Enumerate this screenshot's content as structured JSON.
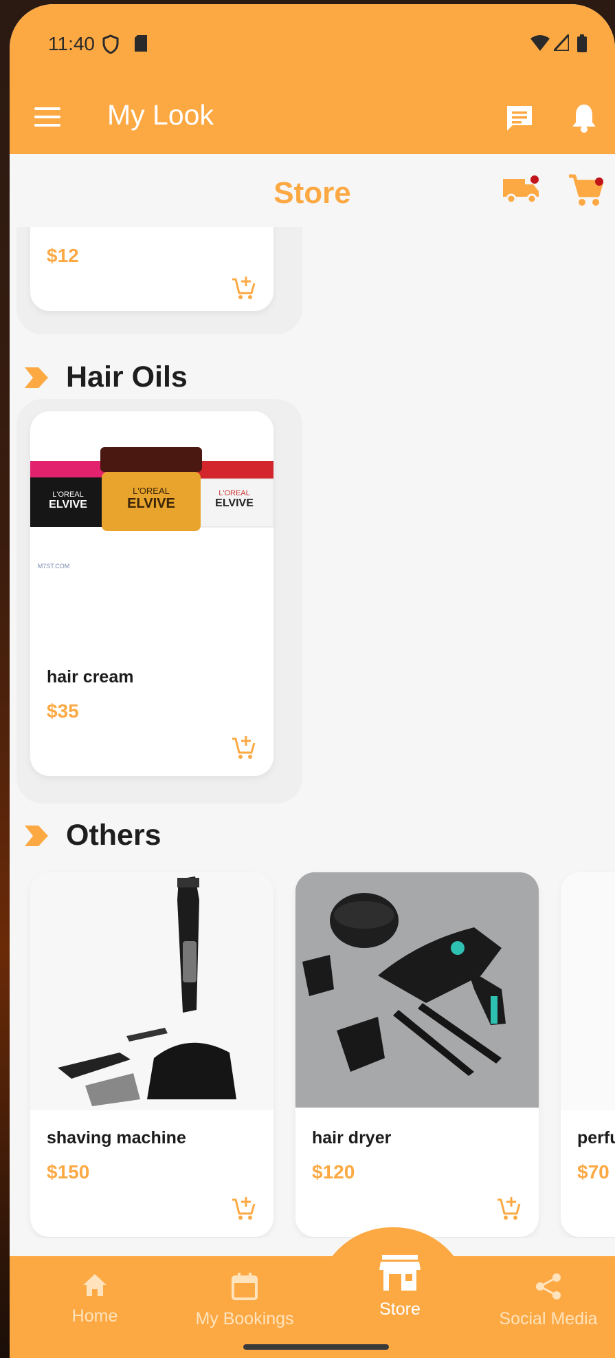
{
  "status": {
    "time": "11:40"
  },
  "appbar": {
    "title": "My Look"
  },
  "store": {
    "title": "Store"
  },
  "partial_top_card": {
    "price": "$12"
  },
  "sections": [
    {
      "title": "Hair Oils",
      "products": [
        {
          "name": "hair cream",
          "price": "$35",
          "brand_text": "L'OREAL ELVIVE",
          "watermark": "M7ST.COM"
        }
      ]
    },
    {
      "title": "Others",
      "products": [
        {
          "name": "shaving machine",
          "price": "$150"
        },
        {
          "name": "hair dryer",
          "price": "$120"
        },
        {
          "name": "perfu",
          "price": "$70"
        }
      ]
    }
  ],
  "bottom_nav": [
    {
      "label": "Home",
      "icon": "home-icon",
      "active": false
    },
    {
      "label": "My Bookings",
      "icon": "calendar-icon",
      "active": false
    },
    {
      "label": "Store",
      "icon": "store-icon",
      "active": true
    },
    {
      "label": "Social Media",
      "icon": "share-icon",
      "active": false
    }
  ],
  "colors": {
    "accent": "#fca944",
    "background": "#f6f6f6",
    "badge": "#c0151b"
  }
}
